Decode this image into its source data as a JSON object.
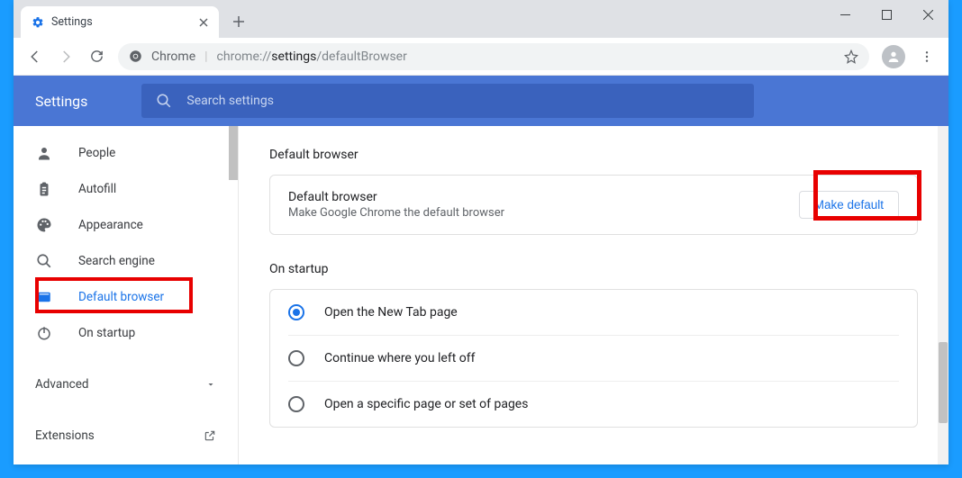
{
  "tab": {
    "title": "Settings"
  },
  "address": {
    "scheme_label": "Chrome",
    "url_prefix": "chrome://",
    "url_bold": "settings",
    "url_rest": "/defaultBrowser"
  },
  "settings_title": "Settings",
  "search_placeholder": "Search settings",
  "sidebar": {
    "items": [
      {
        "icon": "person-icon",
        "label": "People"
      },
      {
        "icon": "clipboard-icon",
        "label": "Autofill"
      },
      {
        "icon": "palette-icon",
        "label": "Appearance"
      },
      {
        "icon": "search-icon",
        "label": "Search engine"
      },
      {
        "icon": "browser-icon",
        "label": "Default browser"
      },
      {
        "icon": "power-icon",
        "label": "On startup"
      }
    ],
    "advanced_label": "Advanced",
    "extensions_label": "Extensions"
  },
  "main": {
    "section_default_title": "Default browser",
    "default_card": {
      "title": "Default browser",
      "subtitle": "Make Google Chrome the default browser",
      "button_label": "Make default"
    },
    "section_startup_title": "On startup",
    "startup_options": [
      {
        "label": "Open the New Tab page",
        "checked": true
      },
      {
        "label": "Continue where you left off",
        "checked": false
      },
      {
        "label": "Open a specific page or set of pages",
        "checked": false
      }
    ]
  }
}
